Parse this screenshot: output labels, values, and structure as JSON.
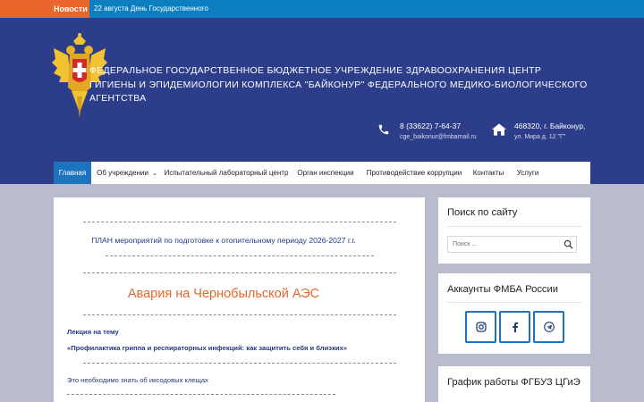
{
  "ticker": {
    "label": "Новости",
    "text": "22 августа День Государственного"
  },
  "header": {
    "org_title": "Федеральное государственное бюджетное учреждение здравоохранения Центр гигиены и эпидемиологии комплекса \"Байконур\" Федерального медико-биологического агентства",
    "phone": "8 (33622) 7-64-37",
    "email": "cge_baikonur@fmbamail.ru",
    "address_line1": "468320, г. Байконур,",
    "address_line2": "ул. Мира д. 12 \"Г\""
  },
  "nav": {
    "items": [
      {
        "label": "Главная"
      },
      {
        "label": "Об учреждении"
      },
      {
        "label": "Испытательный лабораторный центр"
      },
      {
        "label": "Орган инспекции"
      },
      {
        "label": "Противодействие коррупции"
      },
      {
        "label": "Контакты"
      },
      {
        "label": "Услуги"
      }
    ]
  },
  "content": {
    "plan_link": "ПЛАН мероприятий по подготовке к отопительному периоду 2026-2027 г.г.",
    "chernobyl": "Авария на Чернобыльской АЭС",
    "lecture_line1": "Лекция на тему",
    "lecture_line2": "«Профилактика гриппа и респираторных инфекций: как защитить себя и близких»",
    "ticks": "Это необходимо знать об иксодовых клещах"
  },
  "sidebar": {
    "search_title": "Поиск по сайту",
    "search_placeholder": "Поиск ...",
    "social_title": "Аккаунты ФМБА России",
    "hours_title": "График работы ФГБУЗ ЦГиЭ"
  },
  "colors": {
    "header_bg": "#2c3e8a",
    "ticker_bg": "#0d7fc0",
    "accent_orange": "#e8662b",
    "nav_active": "#1e73be",
    "link_blue": "#203a80"
  },
  "icons": [
    "emblem-icon",
    "phone-icon",
    "home-icon",
    "search-icon",
    "instagram-icon",
    "facebook-icon",
    "telegram-icon",
    "chevron-down-icon"
  ]
}
